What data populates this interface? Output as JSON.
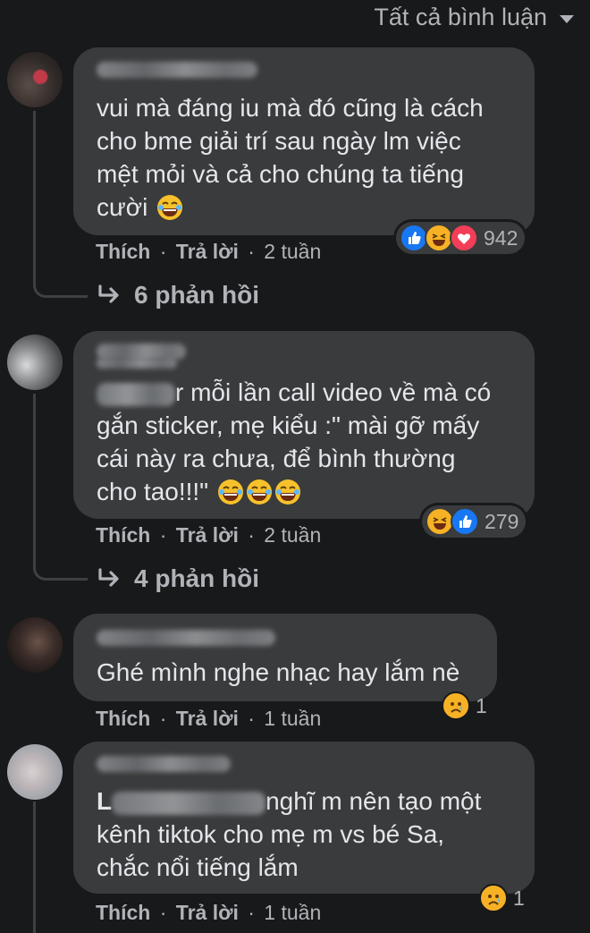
{
  "header": {
    "filter_label": "Tất cả bình luận"
  },
  "comments": [
    {
      "text_lines": [
        "vui mà đáng iu mà đó cũng là cách",
        "cho bme giải trí sau ngày lm việc",
        "mệt mỏi và cả cho chúng ta tiếng",
        "cười"
      ],
      "like_label": "Thích",
      "reply_label": "Trả lời",
      "time": "2 tuần",
      "reaction_count": "942",
      "reactions": [
        "like-icon",
        "haha-icon",
        "love-icon"
      ],
      "replies_label": "6 phản hồi"
    },
    {
      "text_lines": [
        "r mỗi lần call video về mà có",
        "gắn sticker, mẹ kiểu :\" mài gỡ mấy",
        "cái này ra chưa, để bình thường",
        "cho tao!!!\""
      ],
      "like_label": "Thích",
      "reply_label": "Trả lời",
      "time": "2 tuần",
      "reaction_count": "279",
      "reactions": [
        "haha-icon",
        "like-icon"
      ],
      "replies_label": "4 phản hồi"
    },
    {
      "text_lines": [
        "Ghé mình nghe nhạc hay lắm nè"
      ],
      "like_label": "Thích",
      "reply_label": "Trả lời",
      "time": "1 tuần",
      "reaction_count": "1",
      "reactions": [
        "sad-icon"
      ]
    },
    {
      "text_lines": [
        "L",
        "nghĩ m nên tạo một",
        "kênh tiktok cho mẹ m vs bé Sa,",
        "chắc nổi tiếng lắm"
      ],
      "like_label": "Thích",
      "reply_label": "Trả lời",
      "time": "1 tuần",
      "reaction_count": "1",
      "reactions": [
        "sad-icon"
      ]
    }
  ],
  "colors": {
    "background": "#18191a",
    "bubble": "#3a3b3c",
    "like": "#1877f2",
    "love": "#f33e58",
    "haha": "#f7b125",
    "muted_text": "#b0b3b8"
  }
}
